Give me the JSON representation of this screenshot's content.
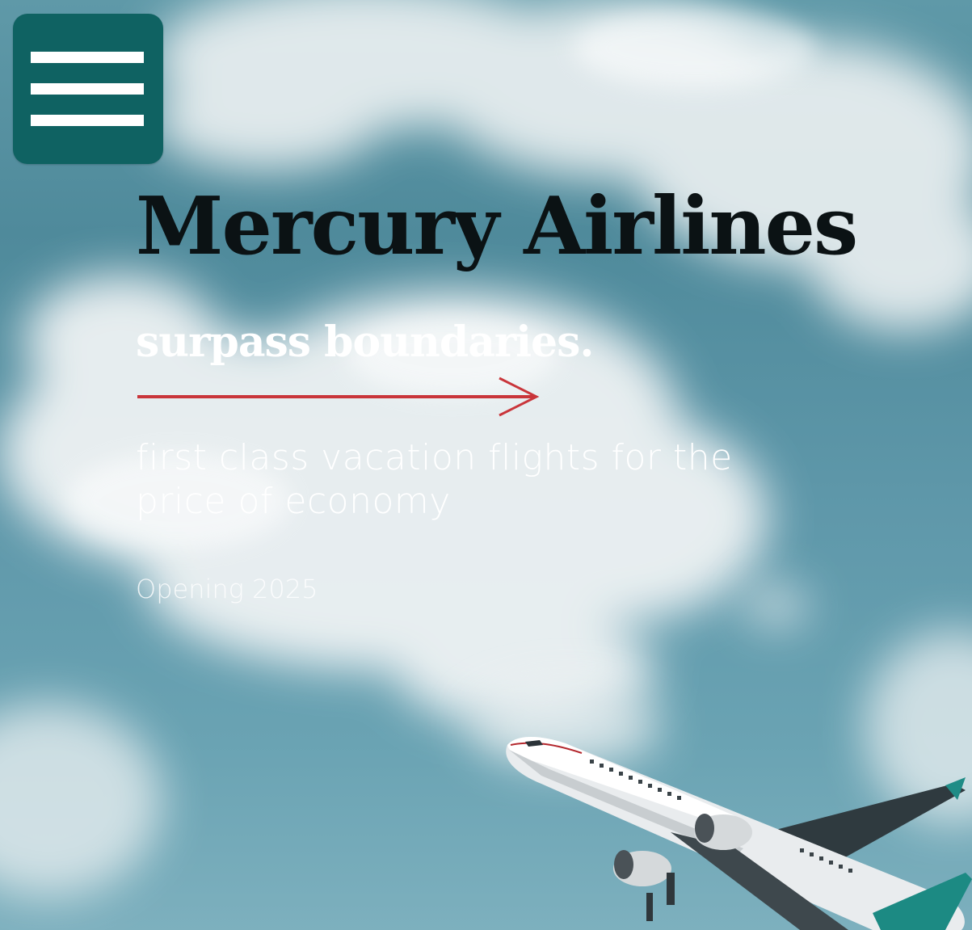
{
  "hero": {
    "title": "Mercury Airlines",
    "tagline": "surpass boundaries.",
    "subtitle": "first class vacation flights for the price of economy",
    "opening": "Opening 2025"
  },
  "menu": {
    "icon": "hamburger-menu-icon"
  },
  "colors": {
    "menu_background": "#0f6262",
    "title": "#0b1214",
    "accent_arrow": "#c9353a",
    "text_light": "#ffffff",
    "sky": "#5f99a8"
  }
}
